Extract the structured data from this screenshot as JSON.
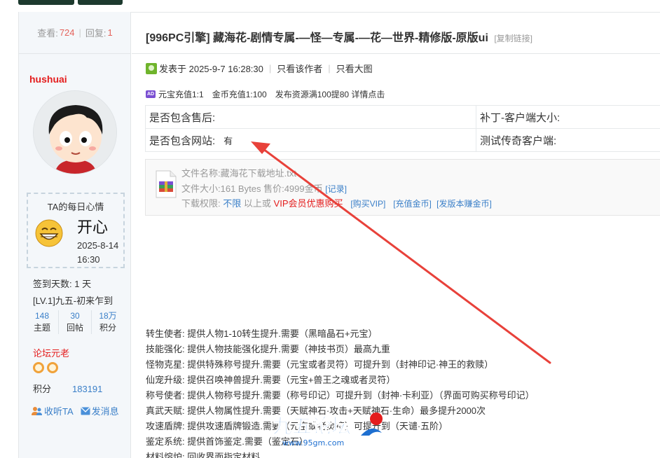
{
  "sidebar": {
    "views_label": "查看:",
    "views": "724",
    "replies_label": "回复:",
    "replies": "1",
    "username": "hushuai",
    "mood": {
      "title": "TA的每日心情",
      "text": "开心",
      "date": "2025-8-14 16:30"
    },
    "sign_days": "签到天数: 1 天",
    "level": "[LV.1]九五-初来乍到",
    "stats": [
      {
        "num": "148",
        "label": "主题"
      },
      {
        "num": "30",
        "label": "回帖"
      },
      {
        "num": "18万",
        "label": "积分"
      }
    ],
    "rank": "论坛元老",
    "points_label": "积分",
    "points_value": "183191",
    "follow_label": "收听TA",
    "message_label": "发消息"
  },
  "post": {
    "title": "[996PC引擎] 藏海花-剧情专属-—怪—专属-—花—世界-精修版-原版ui",
    "copy_link": "[复制链接]",
    "posted_at": "发表于 2025-9-7 16:28:30",
    "author_only": "只看该作者",
    "big_image": "只看大图",
    "ad": {
      "icon": "AD",
      "text1": "元宝充值1:1",
      "text2": "金币充值1:100",
      "text3": "发布资源满100提80 详情点击"
    },
    "info_table": [
      [
        "是否包含售后:",
        "",
        "补丁-客户端大小:"
      ],
      [
        "是否包含网站:",
        "有",
        "测试传奇客户端:"
      ]
    ],
    "attachment": {
      "filename_label": "文件名称:",
      "filename": "藏海花下载地址.txt",
      "size_label": "文件大小:",
      "size": "161 Bytes",
      "price_label": "售价:",
      "price": "4999金币",
      "record": "[记录]",
      "perm_label": "下载权限:",
      "perm_unlimited": "不限",
      "perm_or": "以上或",
      "vip": "VIP会员优惠购买",
      "buy_vip": "[购买VIP]",
      "recharge": "[充值金币]",
      "earn": "[发版本赚金币]"
    },
    "description": [
      "转生使者:  提供人物1-10转生提升.需要（黑暗晶石+元宝）",
      "技能强化:  提供人物技能强化提升.需要（神技书页）最高九重",
      "怪物克星:  提供特殊称号提升.需要（元宝或者灵符）可提升到（封神印记·神王的救赎）",
      "仙宠升级:  提供召唤神兽提升.需要（元宝+兽王之魂或者灵符）",
      "称号使者:  提供人物称号提升.需要（称号印记）可提升到（封神·卡利亚）（界面可购买称号印记）",
      "真武天赋:  提供人物属性提升.需要（天赋神石·攻击+天赋神石·生命）最多提升2000次",
      "攻速盾牌:  提供攻速盾牌锻造.需要（元宝或者灵符）可提升到（天谴·五阶）",
      "鉴定系统:  提供首饰鉴定.需要（鉴定石）",
      "材料熔炉:  回收界面指定材料."
    ],
    "watermark": {
      "logo": "九五论坛",
      "url": "www.95gm.com"
    }
  },
  "colors": {
    "accent": "#3a7fc8",
    "red": "#e41d1d",
    "arrow": "#e8413a"
  }
}
